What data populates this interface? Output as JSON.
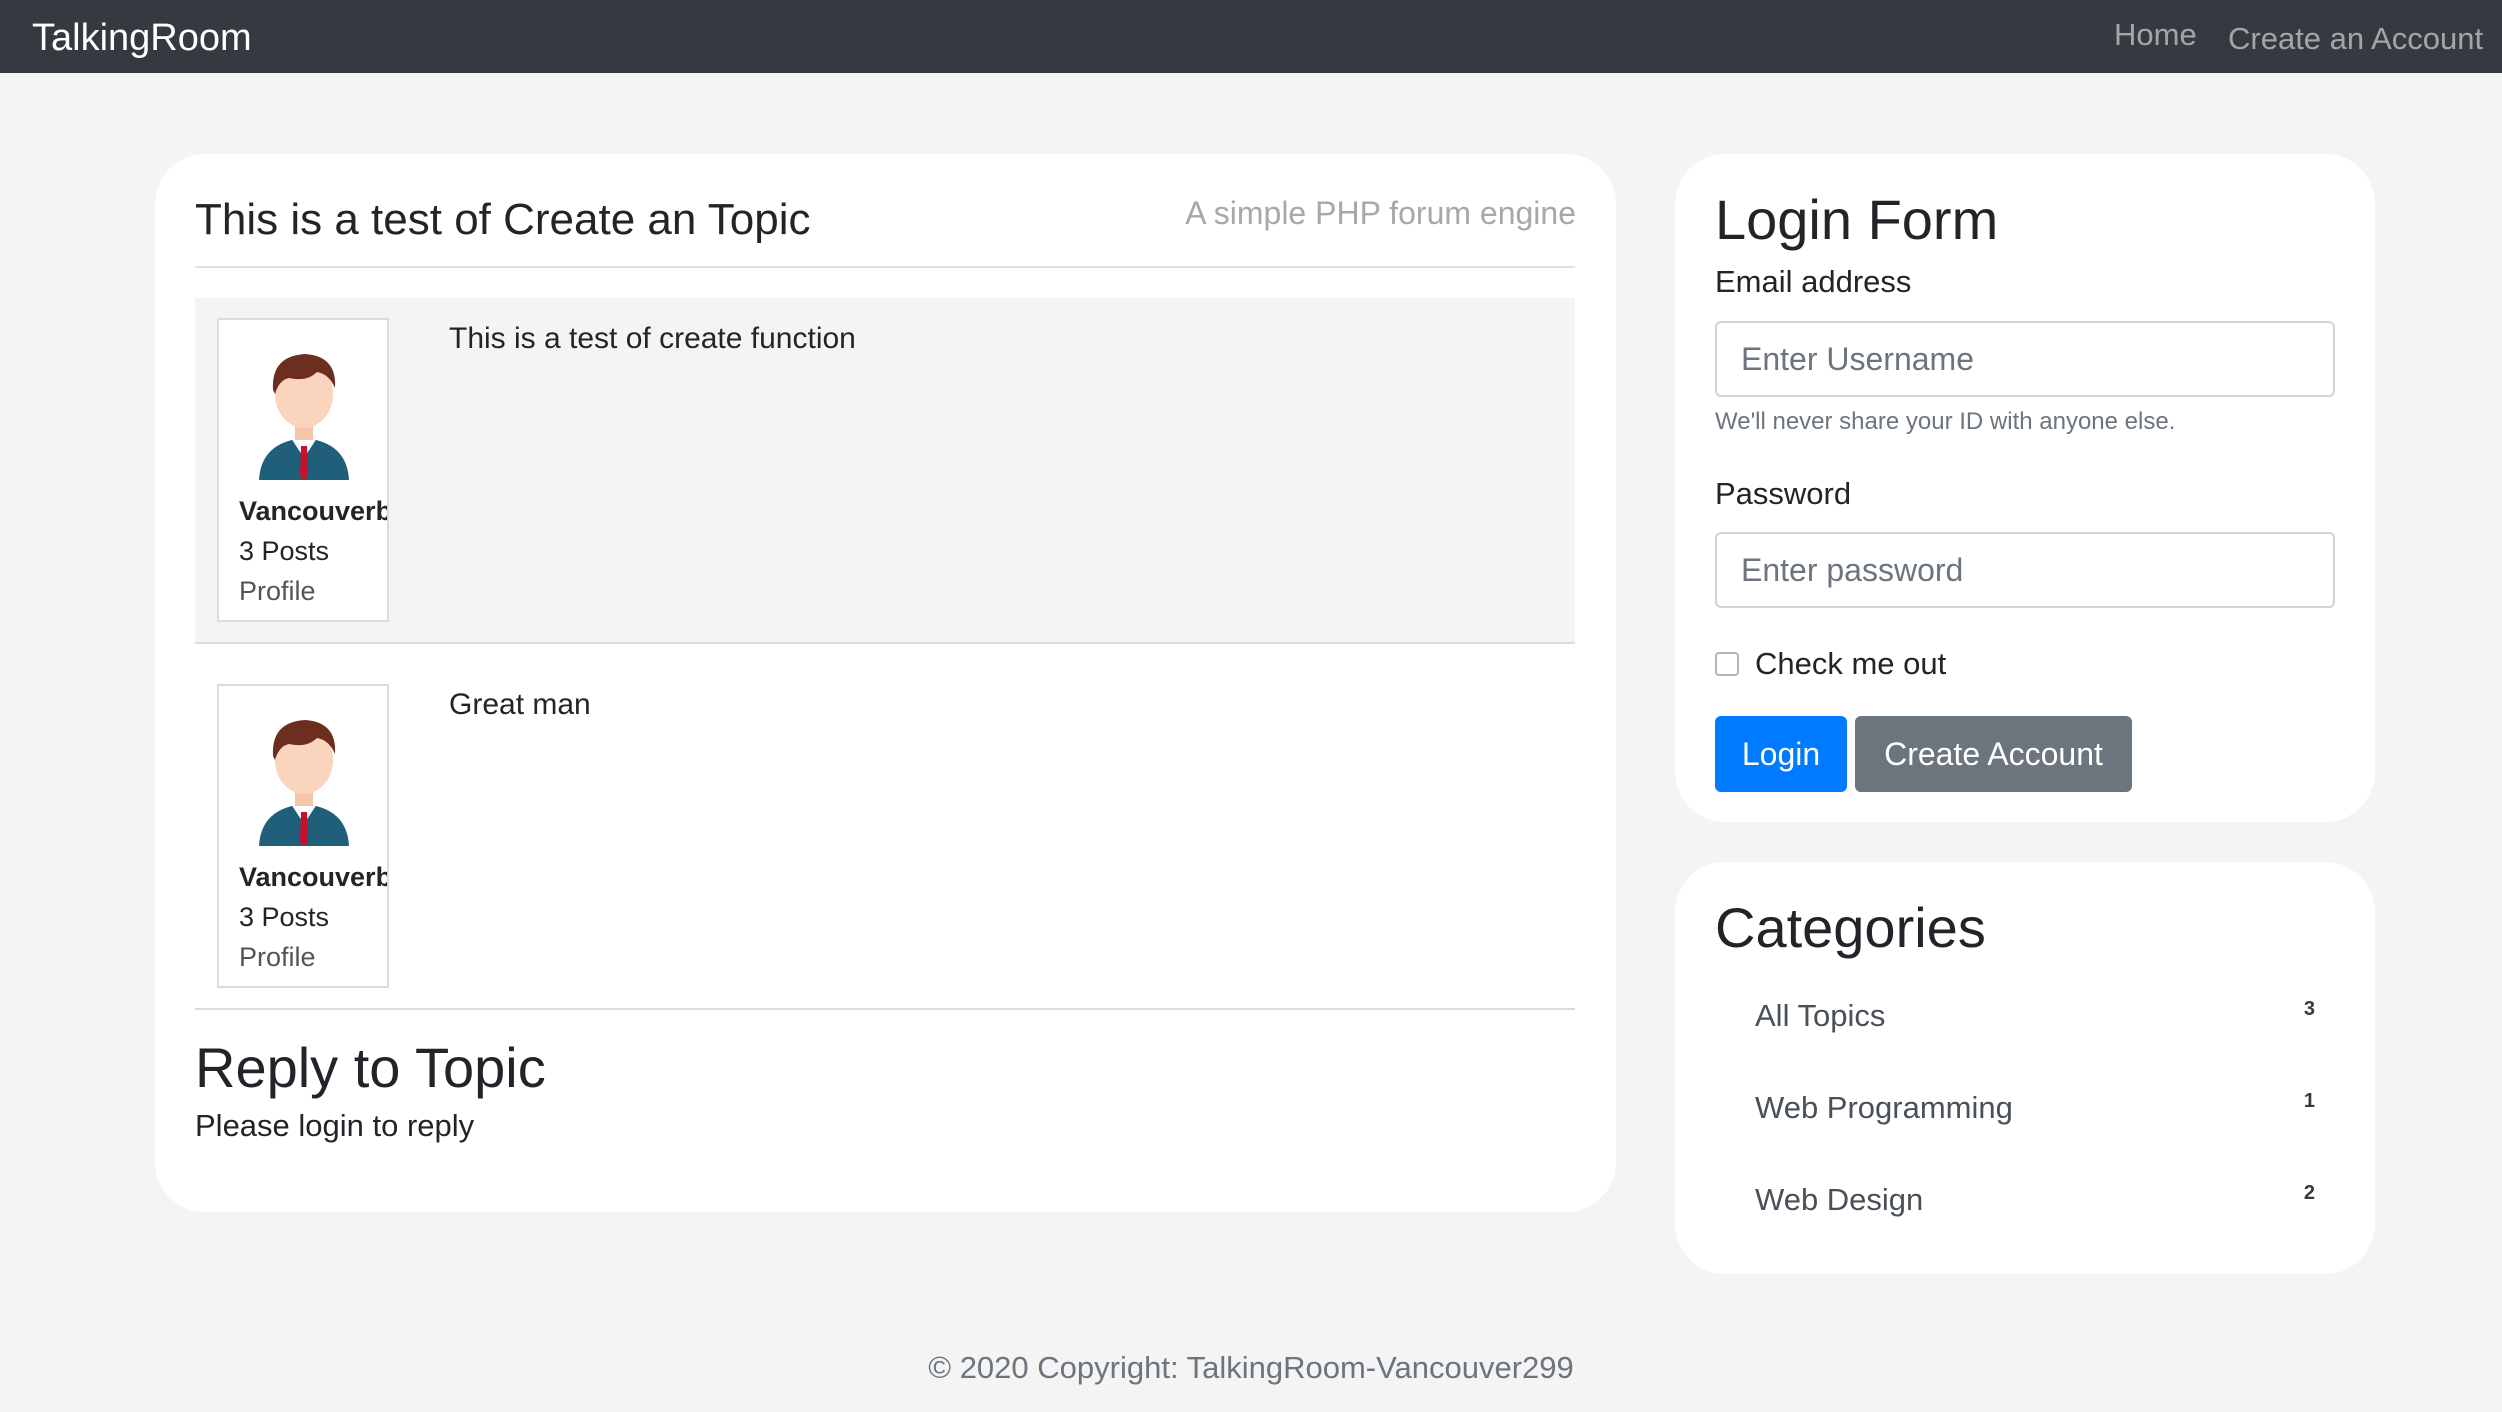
{
  "navbar": {
    "brand": "TalkingRoom",
    "links": [
      {
        "label": "Home"
      },
      {
        "label": "Create an Account"
      }
    ]
  },
  "topic": {
    "title": "This is a test of Create an Topic",
    "tagline": "A simple PHP forum engine",
    "posts": [
      {
        "author": "Vancouverb",
        "post_count": "3 Posts",
        "profile_label": "Profile",
        "avatar_icon": "user-avatar-icon",
        "body": "This is a test of create function"
      },
      {
        "author": "Vancouverb",
        "post_count": "3 Posts",
        "profile_label": "Profile",
        "avatar_icon": "user-avatar-icon",
        "body": "Great man"
      }
    ],
    "reply_title": "Reply to Topic",
    "reply_note": "Please login to reply"
  },
  "login": {
    "title": "Login Form",
    "email_label": "Email address",
    "email_placeholder": "Enter Username",
    "email_help": "We'll never share your ID with anyone else.",
    "password_label": "Password",
    "password_placeholder": "Enter password",
    "remember_label": "Check me out",
    "remember_checked": false,
    "login_button": "Login",
    "create_button": "Create Account",
    "colors": {
      "primary": "#007bff",
      "secondary": "#6c757d"
    }
  },
  "categories": {
    "title": "Categories",
    "items": [
      {
        "label": "All Topics",
        "count": "3"
      },
      {
        "label": "Web Programming",
        "count": "1"
      },
      {
        "label": "Web Design",
        "count": "2"
      }
    ]
  },
  "footer": {
    "text": "© 2020 Copyright: TalkingRoom-Vancouver299"
  }
}
